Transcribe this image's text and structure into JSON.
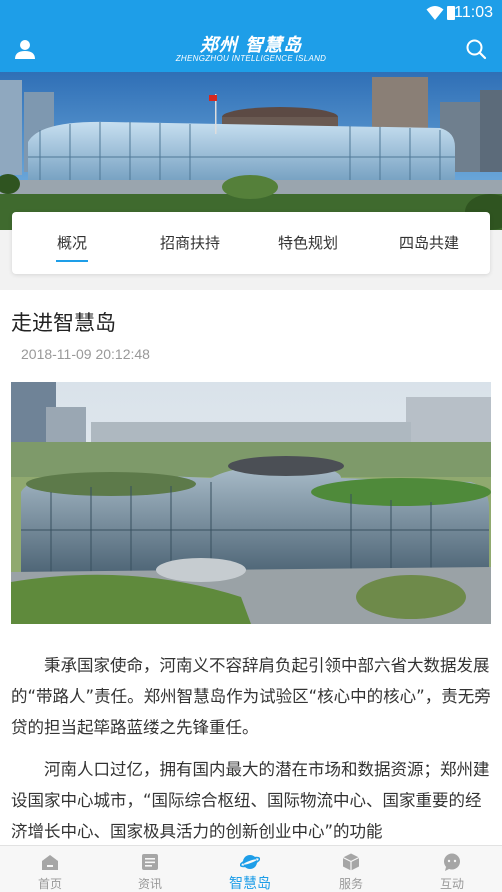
{
  "status_bar": {
    "time": "11:03"
  },
  "header": {
    "title_cn": "郑州 智慧岛",
    "title_en": "ZHENGZHOU INTELLIGENCE ISLAND"
  },
  "tabs": [
    {
      "label": "概况",
      "active": true
    },
    {
      "label": "招商扶持",
      "active": false
    },
    {
      "label": "特色规划",
      "active": false
    },
    {
      "label": "四岛共建",
      "active": false
    }
  ],
  "article": {
    "title": "走进智慧岛",
    "date": "2018-11-09 20:12:48",
    "paragraphs": [
      "秉承国家使命，河南义不容辞肩负起引领中部六省大数据发展的“带路人”责任。郑州智慧岛作为试验区“核心中的核心”，责无旁贷的担当起筚路蓝缕之先锋重任。",
      "河南人口过亿，拥有国内最大的潜在市场和数据资源；郑州建设国家中心城市，“国际综合枢纽、国际物流中心、国家重要的经济增长中心、国家极具活力的创新创业中心”的功能"
    ]
  },
  "bottom_nav": [
    {
      "label": "首页",
      "icon": "home-icon",
      "active": false
    },
    {
      "label": "资讯",
      "icon": "news-icon",
      "active": false
    },
    {
      "label": "智慧岛",
      "icon": "planet-icon",
      "active": true
    },
    {
      "label": "服务",
      "icon": "box-icon",
      "active": false
    },
    {
      "label": "互动",
      "icon": "chat-icon",
      "active": false
    }
  ],
  "colors": {
    "brand": "#1e9ee8",
    "inactive": "#999999"
  }
}
